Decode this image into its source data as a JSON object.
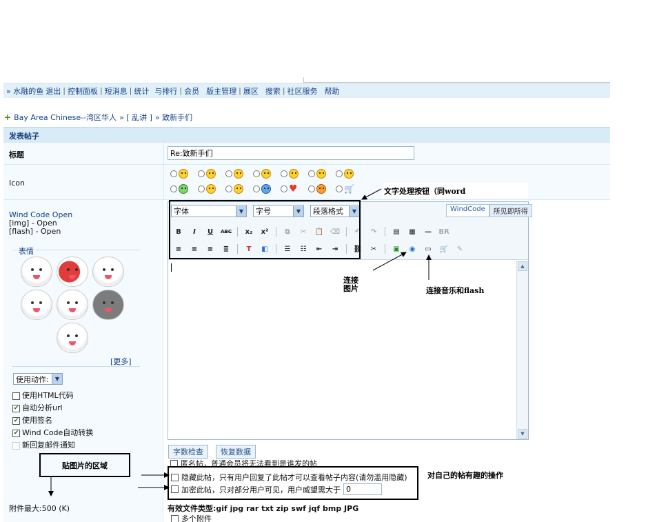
{
  "nav": {
    "user": "» 水融的鱼",
    "logout": "退出",
    "control_panel": "控制面板",
    "messages": "短消息",
    "stats": "统计",
    "ranking": "与排行",
    "members": "会员",
    "moderator": "版主管理",
    "showcase": "展区",
    "search": "搜索",
    "services": "社区服务",
    "help": "帮助"
  },
  "breadcrumb": {
    "site": "Bay Area Chinese--湾区华人",
    "section": "» [ 乱讲 ]",
    "thread": "» 致新手们"
  },
  "form": {
    "header": "发表帖子",
    "title_label": "标题",
    "title_value": "Re:致新手们",
    "icon_label": "Icon"
  },
  "left": {
    "wind_code": "Wind Code Open",
    "img": "[img] - Open",
    "flash": "[flash] - Open",
    "emoticons_legend": "表情",
    "more": "[更多]",
    "action_select": "使用动作:",
    "checkboxes": [
      {
        "label": "使用HTML代码",
        "checked": false
      },
      {
        "label": "自动分析url",
        "checked": true
      },
      {
        "label": "使用签名",
        "checked": true
      },
      {
        "label": "Wind Code自动转换",
        "checked": true
      },
      {
        "label": "新回复邮件通知",
        "checked": false
      }
    ],
    "attach_max": "附件最大:500 (K)"
  },
  "editor": {
    "font_select": "字体",
    "size_select": "字号",
    "para_select": "段落格式",
    "mode_windcode": "WindCode",
    "mode_wysiwyg": "所见即所得",
    "br_label": "BR",
    "wordcount_button": "字数检查",
    "restore_button": "恢复数据"
  },
  "options": {
    "anonymous": "匿名帖，普通会员将无法看到是谁发的帖",
    "hide_post": "隐藏此帖，只有用户回复了此帖才可以查看帖子内容(请勿滥用隐藏)",
    "encrypt_post": "加密此帖，只对部分用户可见，用户威望需大于",
    "encrypt_value": "0",
    "file_types": "有效文件类型:gif jpg rar txt zip swf jqf bmp JPG",
    "multi_attach": "多个附件"
  },
  "annotations": {
    "format_buttons": "文字处理按钮（同word",
    "link_image_1": "连接",
    "link_image_2": "图片",
    "link_media": "连接音乐和flash",
    "paste_area": "贴图片的区域",
    "own_post_ops": "对自己的帖有趣的操作"
  }
}
